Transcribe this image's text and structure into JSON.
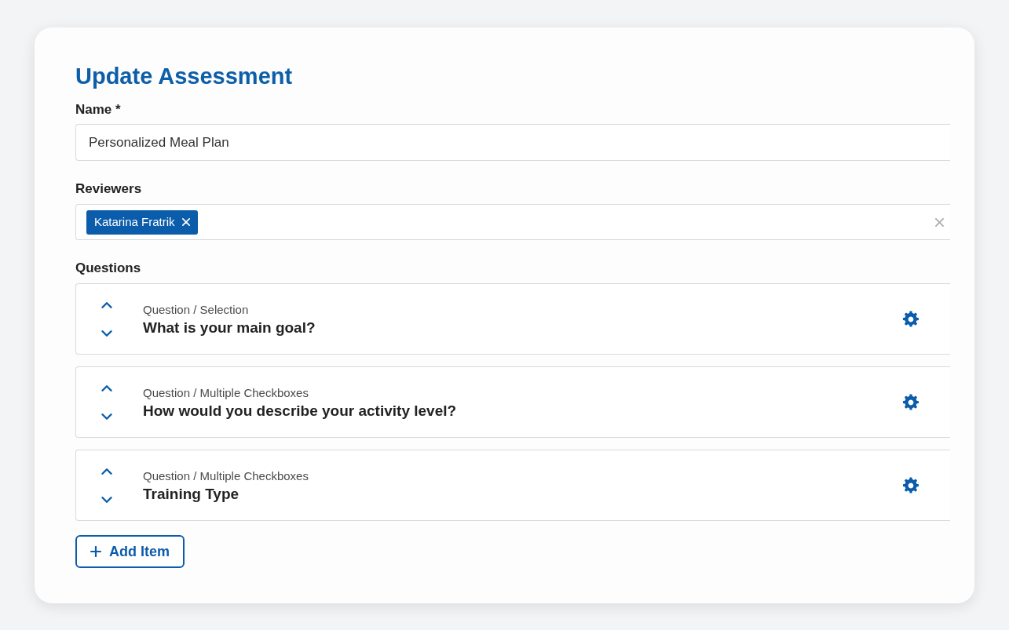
{
  "title": "Update Assessment",
  "name_field": {
    "label": "Name *",
    "value": "Personalized Meal Plan"
  },
  "reviewers_field": {
    "label": "Reviewers",
    "chips": [
      {
        "label": "Katarina Fratrik"
      }
    ]
  },
  "questions": {
    "label": "Questions",
    "items": [
      {
        "type_label": "Question / Selection",
        "title": "What is your main goal?"
      },
      {
        "type_label": "Question / Multiple Checkboxes",
        "title": "How would you describe your activity level?"
      },
      {
        "type_label": "Question / Multiple Checkboxes",
        "title": "Training Type"
      }
    ]
  },
  "add_button": {
    "label": "Add Item"
  }
}
